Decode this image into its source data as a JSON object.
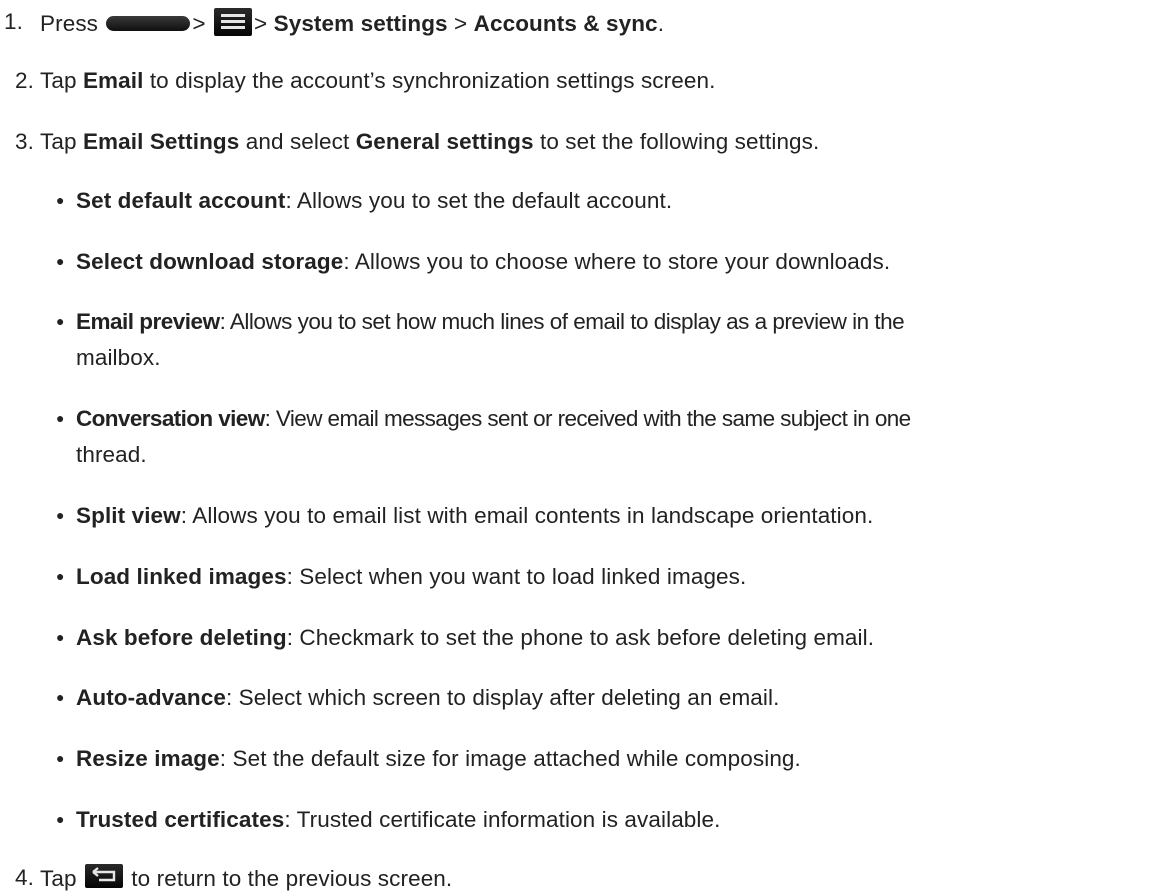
{
  "steps": [
    {
      "number": "1.",
      "press": "Press",
      "sep1": ">",
      "sep2": ">",
      "system_settings": "System settings",
      "sep3": ">",
      "accounts_sync": "Accounts & sync",
      "end": "."
    },
    {
      "number": "2.",
      "tap": "Tap",
      "bold": "Email",
      "rest": "to display the account’s synchronization settings screen."
    },
    {
      "number": "3.",
      "tap": "Tap",
      "bold1": "Email Settings",
      "mid": "and select",
      "bold2": "General settings",
      "rest": "to set the following settings."
    },
    {
      "number": "4.",
      "tap": "Tap",
      "rest": "to return to the previous screen."
    }
  ],
  "settings": [
    {
      "term": "Set default account",
      "desc": ": Allows you to set the default account."
    },
    {
      "term": "Select download storage",
      "desc": ": Allows you to choose where to store your downloads."
    },
    {
      "term": "Email preview",
      "desc": ": Allows you to set how much lines of email to display as a preview in the",
      "desc_cont": "mailbox."
    },
    {
      "term": "Conversation view",
      "desc": ": View email messages sent or received with the same subject in one",
      "desc_cont": "thread."
    },
    {
      "term": "Split view",
      "desc": ": Allows you to email list with email contents in landscape orientation."
    },
    {
      "term": "Load linked images",
      "desc": ": Select when you want to load linked images."
    },
    {
      "term": "Ask before deleting",
      "desc": ": Checkmark to set the phone to ask before deleting email."
    },
    {
      "term": "Auto-advance",
      "desc": ": Select which screen to display after deleting an email."
    },
    {
      "term": "Resize image",
      "desc": ": Set the default size for image attached while composing."
    },
    {
      "term": "Trusted certificates",
      "desc": ": Trusted certificate information is available."
    }
  ],
  "icons": {
    "home_key": "home-key-icon",
    "menu_key": "menu-key-icon",
    "back_key": "back-key-icon"
  }
}
